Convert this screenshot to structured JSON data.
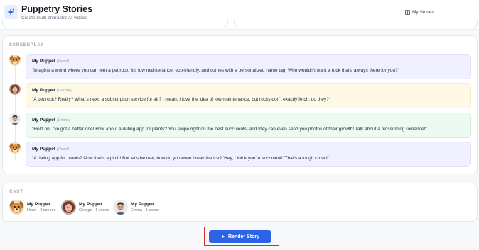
{
  "header": {
    "title": "Puppetry Stories",
    "subtitle": "Create multi-character AI videos",
    "my_stories_label": "My Stories",
    "accent_color": "#2c63e8"
  },
  "screenplay": {
    "label": "SCREENPLAY",
    "lines": [
      {
        "name": "My Puppet",
        "voice": "(Heart)",
        "avatar": "dog",
        "color": "purple",
        "text": "\"Imagine a world where you can rent a pet rock! It's low maintenance, eco-friendly, and comes with a personalized name tag. Who wouldn't want a rock that's always there for you?\""
      },
      {
        "name": "My Puppet",
        "voice": "(George)",
        "avatar": "woman",
        "color": "yellow",
        "text": "\"A pet rock? Really? What's next, a subscription service for air? I mean, I love the idea of low maintenance, but rocks don't exactly fetch, do they?\""
      },
      {
        "name": "My Puppet",
        "voice": "(Emma)",
        "avatar": "man",
        "color": "green",
        "text": "\"Hold on, I've got a better one! How about a dating app for plants? You swipe right on the best succulents, and they can even send you photos of their growth! Talk about a blossoming romance!\""
      },
      {
        "name": "My Puppet",
        "voice": "(Heart)",
        "avatar": "dog",
        "color": "purple",
        "text": "\"A dating app for plants? Now that's a pitch! But let's be real, how do you even break the ice? 'Hey, I think you're succulent!' That's a tough crowd!\""
      }
    ]
  },
  "cast": {
    "label": "CAST",
    "members": [
      {
        "name": "My Puppet",
        "meta": "Heart · 2 scenes",
        "avatar": "dog"
      },
      {
        "name": "My Puppet",
        "meta": "George · 1 scene",
        "avatar": "woman"
      },
      {
        "name": "My Puppet",
        "meta": "Emma · 1 scene",
        "avatar": "man"
      }
    ]
  },
  "actions": {
    "render_label": "Render Story"
  }
}
